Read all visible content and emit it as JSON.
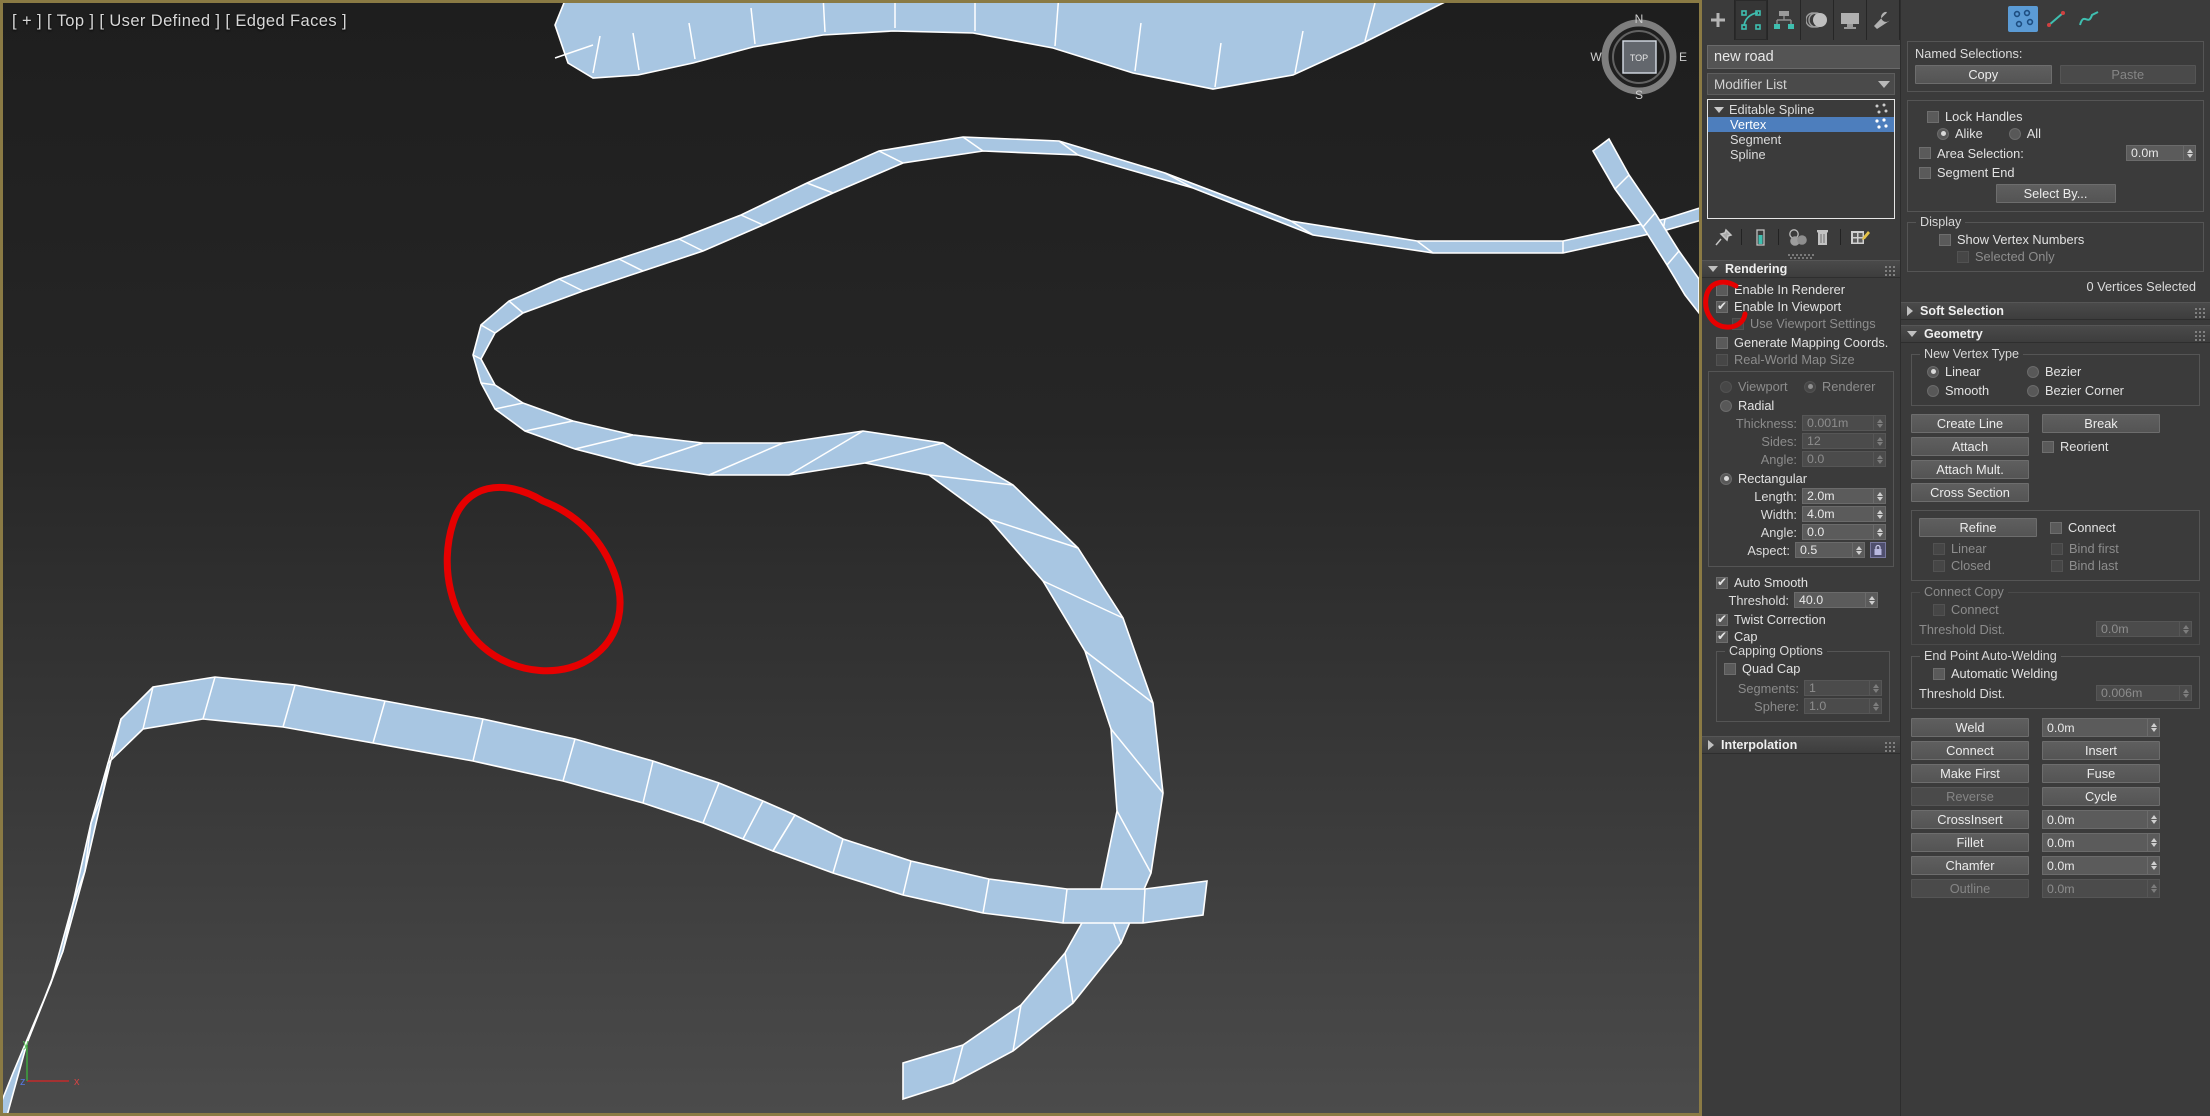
{
  "viewport": {
    "label": "[ + ] [ Top ] [ User Defined ] [ Edged Faces ]",
    "viewcube_face": "TOP",
    "compass": {
      "n": "N",
      "e": "E",
      "s": "S",
      "w": "W"
    },
    "axis": {
      "x": "x",
      "y": "y",
      "z": "z"
    },
    "colors": {
      "road_fill": "#a8c6e2",
      "road_edge": "#ffffff",
      "annotation": "#e60000",
      "border": "#8a7a44"
    }
  },
  "command_panel": {
    "tabs": [
      {
        "name": "create",
        "selected": false
      },
      {
        "name": "modify",
        "selected": true
      },
      {
        "name": "hierarchy",
        "selected": false
      },
      {
        "name": "motion",
        "selected": false
      },
      {
        "name": "display",
        "selected": false
      },
      {
        "name": "utilities",
        "selected": false
      }
    ],
    "object_name": "new road",
    "object_name_placeholder": "new road",
    "modifier_list_label": "Modifier List",
    "stack": [
      {
        "label": "Editable Spline",
        "selected": false,
        "level": 0
      },
      {
        "label": "Vertex",
        "selected": true,
        "level": 1
      },
      {
        "label": "Segment",
        "selected": false,
        "level": 1
      },
      {
        "label": "Spline",
        "selected": false,
        "level": 1
      }
    ],
    "stack_tools": [
      {
        "name": "pin-stack-icon"
      },
      {
        "name": "show-end-result-icon"
      },
      {
        "name": "make-unique-icon"
      },
      {
        "name": "remove-modifier-icon"
      },
      {
        "name": "configure-modifier-sets-icon"
      }
    ]
  },
  "rendering": {
    "title": "Rendering",
    "enable_in_renderer": {
      "label": "Enable In Renderer",
      "checked": false
    },
    "enable_in_viewport": {
      "label": "Enable In Viewport",
      "checked": true
    },
    "use_viewport_settings": {
      "label": "Use Viewport Settings",
      "checked": false,
      "enabled": false
    },
    "generate_mapping_coords": {
      "label": "Generate Mapping Coords.",
      "checked": false
    },
    "real_world_map_size": {
      "label": "Real-World Map Size",
      "checked": false,
      "enabled": false
    },
    "viewport_radio": {
      "label": "Viewport",
      "selected": false,
      "enabled": false
    },
    "renderer_radio": {
      "label": "Renderer",
      "selected": true,
      "enabled": false
    },
    "radial": {
      "label": "Radial",
      "selected": false
    },
    "thickness": {
      "label": "Thickness:",
      "value": "0.001m",
      "enabled": false
    },
    "sides": {
      "label": "Sides:",
      "value": "12",
      "enabled": false
    },
    "radial_angle": {
      "label": "Angle:",
      "value": "0.0",
      "enabled": false
    },
    "rectangular": {
      "label": "Rectangular",
      "selected": true
    },
    "length": {
      "label": "Length:",
      "value": "2.0m"
    },
    "width": {
      "label": "Width:",
      "value": "4.0m"
    },
    "rect_angle": {
      "label": "Angle:",
      "value": "0.0"
    },
    "aspect": {
      "label": "Aspect:",
      "value": "0.5",
      "lock_icon": "lock-icon"
    },
    "auto_smooth": {
      "label": "Auto Smooth",
      "checked": true
    },
    "threshold": {
      "label": "Threshold:",
      "value": "40.0"
    },
    "twist_correction": {
      "label": "Twist Correction",
      "checked": true
    },
    "cap": {
      "label": "Cap",
      "checked": true
    },
    "capping_options": {
      "title": "Capping Options",
      "quad_cap": {
        "label": "Quad Cap",
        "checked": false
      },
      "segments": {
        "label": "Segments:",
        "value": "1",
        "enabled": false
      },
      "sphere": {
        "label": "Sphere:",
        "value": "1.0",
        "enabled": false
      }
    }
  },
  "interpolation": {
    "title": "Interpolation"
  },
  "selection": {
    "subobject_icons": [
      {
        "name": "vertex-subobject-icon",
        "selected": true
      },
      {
        "name": "segment-subobject-icon",
        "selected": false
      },
      {
        "name": "spline-subobject-icon",
        "selected": false
      }
    ],
    "named_selections_label": "Named Selections:",
    "copy": "Copy",
    "paste": "Paste",
    "lock_handles": {
      "label": "Lock Handles",
      "checked": false
    },
    "alike": {
      "label": "Alike",
      "selected": true
    },
    "all": {
      "label": "All",
      "selected": false
    },
    "area_selection": {
      "label": "Area Selection:",
      "checked": false,
      "value": "0.0m"
    },
    "segment_end": {
      "label": "Segment End",
      "checked": false
    },
    "select_by": "Select By...",
    "display_group": "Display",
    "show_vertex_numbers": {
      "label": "Show Vertex Numbers",
      "checked": false
    },
    "selected_only": {
      "label": "Selected Only",
      "checked": false,
      "enabled": false
    },
    "status": "0 Vertices Selected"
  },
  "soft_selection": {
    "title": "Soft Selection"
  },
  "geometry": {
    "title": "Geometry",
    "new_vertex_type": {
      "title": "New Vertex Type",
      "linear": {
        "label": "Linear",
        "selected": true
      },
      "bezier": {
        "label": "Bezier",
        "selected": false
      },
      "smooth": {
        "label": "Smooth",
        "selected": false
      },
      "bezier_corner": {
        "label": "Bezier Corner",
        "selected": false
      }
    },
    "create_line": {
      "label": "Create Line",
      "enabled": true
    },
    "break": {
      "label": "Break",
      "enabled": true
    },
    "attach": {
      "label": "Attach",
      "enabled": true
    },
    "reorient": {
      "label": "Reorient",
      "checked": false
    },
    "attach_mult": {
      "label": "Attach Mult.",
      "enabled": true
    },
    "cross_section": {
      "label": "Cross Section",
      "enabled": true
    },
    "refine": {
      "label": "Refine",
      "enabled": true
    },
    "connect_refine": {
      "label": "Connect",
      "checked": false
    },
    "linear": {
      "label": "Linear",
      "checked": false,
      "enabled": false
    },
    "bind_first": {
      "label": "Bind first",
      "checked": false,
      "enabled": false
    },
    "closed": {
      "label": "Closed",
      "checked": false,
      "enabled": false
    },
    "bind_last": {
      "label": "Bind last",
      "checked": false,
      "enabled": false
    },
    "connect_copy": {
      "title": "Connect Copy",
      "connect": {
        "label": "Connect",
        "checked": false,
        "enabled": false
      },
      "threshold_dist": {
        "label": "Threshold Dist.",
        "value": "0.0m",
        "enabled": false
      }
    },
    "end_point_auto_welding": {
      "title": "End Point Auto-Welding",
      "automatic_welding": {
        "label": "Automatic Welding",
        "checked": false
      },
      "threshold_dist": {
        "label": "Threshold Dist.",
        "value": "0.006m",
        "enabled": false
      }
    },
    "buttons": [
      {
        "label": "Weld",
        "enabled": true,
        "value": "0.0m",
        "has_spinner": true
      },
      {
        "label": "Connect",
        "enabled": true,
        "right_label": "Insert",
        "right_enabled": true
      },
      {
        "label": "Make First",
        "enabled": true,
        "right_label": "Fuse",
        "right_enabled": true
      },
      {
        "label": "Reverse",
        "enabled": false,
        "right_label": "Cycle",
        "right_enabled": true
      },
      {
        "label": "CrossInsert",
        "enabled": true,
        "value": "0.0m",
        "has_spinner": true
      },
      {
        "label": "Fillet",
        "enabled": true,
        "value": "0.0m",
        "has_spinner": true
      },
      {
        "label": "Chamfer",
        "enabled": true,
        "value": "0.0m",
        "has_spinner": true
      },
      {
        "label": "Outline",
        "enabled": false,
        "value": "0.0m",
        "has_spinner": true,
        "spinner_enabled": false
      }
    ]
  }
}
